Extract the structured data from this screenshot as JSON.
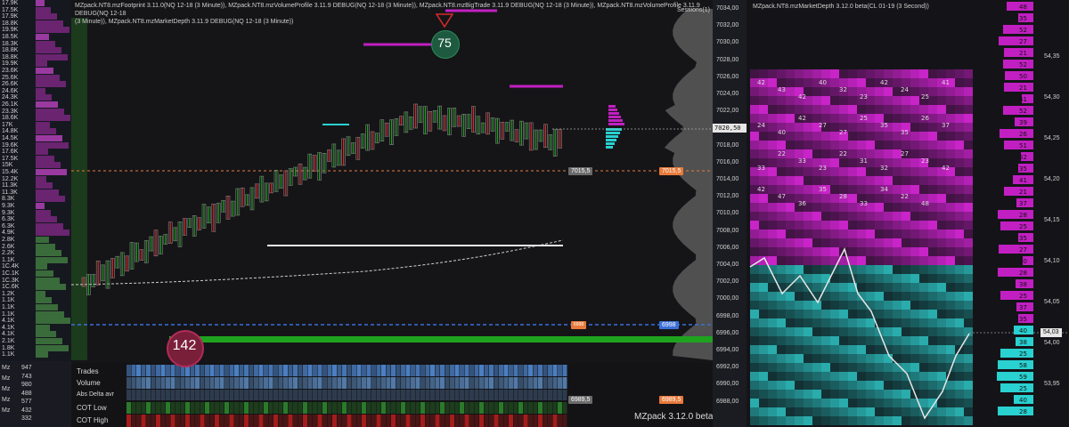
{
  "left_ladder": {
    "prices": [
      "17.9K",
      "17.5K",
      "17.9K",
      "18.8K",
      "19.9K",
      "18.5K",
      "18.3K",
      "18.8K",
      "18.8K",
      "19.9K",
      "23.6K",
      "25.6K",
      "26.6K",
      "24.6K",
      "24.3K",
      "26.1K",
      "23.3K",
      "18.6K",
      "17K",
      "14.8K",
      "14.5K",
      "19.6K",
      "17.6K",
      "17.5K",
      "15K",
      "15.4K",
      "12.2K",
      "11.3K",
      "11.3K",
      "8.3K",
      "9.3K",
      "9.3K",
      "6.3K",
      "6.3K",
      "4.9K",
      "2.8K",
      "2.6K",
      "2.2K",
      "1.1K",
      "1C.4K",
      "1C.1K",
      "1C.3K",
      "1C.6K",
      "1.2K",
      "1.1K",
      "1.1K",
      "1.1K",
      "4.1K",
      "4.1K",
      "4.1K",
      "2.1K",
      "1.8K",
      "1.1K"
    ],
    "bottom_values": [
      "947",
      "743",
      "980",
      "488",
      "577",
      "432",
      "332"
    ],
    "bottom_labels": [
      "Mz",
      "Mz",
      "Mz",
      "Mz",
      "Mz"
    ],
    "status": "Mzpack"
  },
  "header": {
    "line1": "MZpack.NT8.mzFootprint 3.11.0(NQ 12-18 (3 Minute)), MZpack.NT8.mzVolumeProfile 3.11.9 DEBUG(NQ 12-18 (3 Minute)), MZpack.NT8.mzBigTrade 3.11.9 DEBUG(NQ 12-18 (3 Minute)), MZpack.NT8.mzVolumeProfile 3.11.9 DEBUG(NQ 12-18",
    "line2": "(3 Minute)), MZpack.NT8.mzMarketDepth 3.11.9 DEBUG(NQ 12-18 (3 Minute))",
    "sessions": "Sessions(1)"
  },
  "circles": {
    "top": "75",
    "bottom": "142"
  },
  "row_labels": [
    "Trades",
    "Volume",
    "Abs Delta avr",
    "COT Low",
    "COT High"
  ],
  "tags": {
    "level1": "7015,5",
    "level1_right": "7015,5",
    "level2": "6998",
    "level2_right": "6998",
    "level3": "6989,5",
    "level3_right": "6989,5",
    "current_price": "7020,50"
  },
  "version": "MZpack 3.12.0 beta",
  "price_axis": [
    "7034,00",
    "7032,00",
    "7030,00",
    "7028,00",
    "7026,00",
    "7024,00",
    "7022,00",
    "7020,00",
    "7018,00",
    "7016,00",
    "7014,00",
    "7012,00",
    "7010,00",
    "7008,00",
    "7006,00",
    "7004,00",
    "7002,00",
    "7000,00",
    "6998,00",
    "6996,00",
    "6994,00",
    "6992,00",
    "6990,00",
    "6988,00"
  ],
  "right_panel": {
    "title": "MZpack.NT8.mzMarketDepth 3.12.0 beta(CL 01-19 (3 Second))",
    "axis": [
      "54,35",
      "54,30",
      "54,25",
      "54,20",
      "54,15",
      "54,10",
      "54,05",
      "54,00",
      "53,95"
    ],
    "current_price": "54,03",
    "ladder_right": [
      "48",
      "35",
      "52",
      "27",
      "21",
      "52",
      "50",
      "21",
      "61",
      "52",
      "39",
      "26",
      "51",
      "62",
      "35",
      "41",
      "21",
      "37",
      "28",
      "25",
      "35",
      "27",
      "30",
      "28",
      "38",
      "25",
      "37",
      "35",
      "40",
      "38",
      "25",
      "58",
      "59",
      "25",
      "40",
      "28"
    ],
    "numbers": [
      "42",
      "43",
      "42",
      "40",
      "32",
      "23",
      "42",
      "24",
      "25",
      "41",
      "24",
      "40",
      "42",
      "27",
      "27",
      "25",
      "35",
      "35",
      "26",
      "37",
      "33",
      "22",
      "33",
      "23",
      "22",
      "31",
      "32",
      "27",
      "23",
      "42",
      "42",
      "47",
      "36",
      "35",
      "28",
      "33",
      "34",
      "22",
      "48"
    ]
  },
  "colors": {
    "bg": "#151518",
    "magenta": "#c21fc2",
    "cyan": "#2ad1d1",
    "green": "#1fa31f",
    "red": "#d82b2b",
    "orange": "#e87a3a",
    "blue": "#3b6fd8",
    "yellow": "#e6d23a"
  }
}
